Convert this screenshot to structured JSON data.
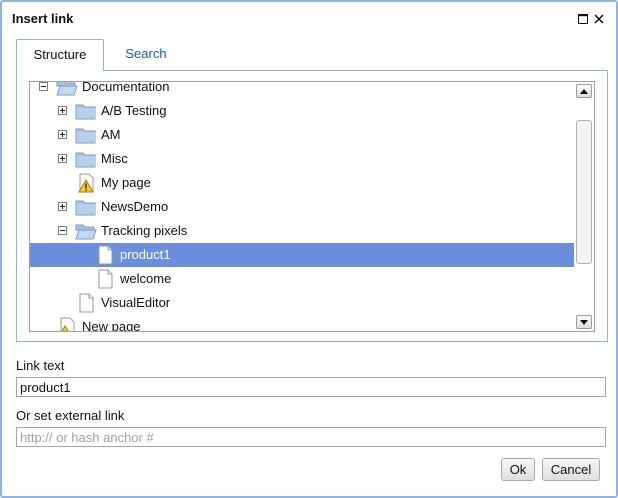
{
  "dialog": {
    "title": "Insert link",
    "maximize_icon": "maximize-icon",
    "close_icon": "close-icon"
  },
  "tabs": [
    {
      "label": "Structure",
      "active": true
    },
    {
      "label": "Search",
      "active": false
    }
  ],
  "tree": {
    "items": [
      {
        "label": "Documentation",
        "icon": "folder-open-icon",
        "expander": "collapse",
        "selected": false
      },
      {
        "label": "A/B Testing",
        "icon": "folder-icon",
        "expander": "expand",
        "selected": false
      },
      {
        "label": "AM",
        "icon": "folder-icon",
        "expander": "expand",
        "selected": false
      },
      {
        "label": "Misc",
        "icon": "folder-icon",
        "expander": "expand",
        "selected": false
      },
      {
        "label": "My page",
        "icon": "warning-icon",
        "expander": "none",
        "selected": false
      },
      {
        "label": "NewsDemo",
        "icon": "folder-icon",
        "expander": "expand",
        "selected": false
      },
      {
        "label": "Tracking pixels",
        "icon": "folder-open-icon",
        "expander": "collapse",
        "selected": false
      },
      {
        "label": "product1",
        "icon": "page-icon",
        "expander": "none",
        "selected": true
      },
      {
        "label": "welcome",
        "icon": "page-icon",
        "expander": "none",
        "selected": false
      },
      {
        "label": "VisualEditor",
        "icon": "page-icon",
        "expander": "none",
        "selected": false
      },
      {
        "label": "New page",
        "icon": "page-warning-icon",
        "expander": "none",
        "selected": false
      }
    ]
  },
  "form": {
    "link_text_label": "Link text",
    "link_text_value": "product1",
    "external_link_label": "Or set external link",
    "external_link_placeholder": "http:// or hash anchor #",
    "external_link_value": ""
  },
  "buttons": {
    "ok": "Ok",
    "cancel": "Cancel"
  },
  "colors": {
    "selection": "#6b8fdd",
    "border_accent": "#8fb4e0",
    "tab_link": "#2255aa"
  }
}
